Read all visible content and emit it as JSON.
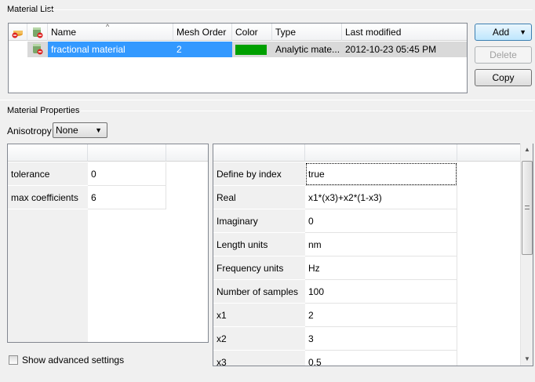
{
  "material_list": {
    "group_label": "Material List",
    "columns": [
      "Name",
      "Mesh Order",
      "Color",
      "Type",
      "Last modified"
    ],
    "rows": [
      {
        "name": "fractional material",
        "mesh_order": "2",
        "color": "#00a000",
        "type": "Analytic mate...",
        "last_modified": "2012-10-23 05:45 PM"
      }
    ],
    "buttons": {
      "add": "Add",
      "delete": "Delete",
      "copy": "Copy"
    }
  },
  "material_properties": {
    "group_label": "Material Properties",
    "anisotropy_label": "Anisotropy",
    "anisotropy_value": "None",
    "left_grid": [
      {
        "key": "tolerance",
        "value": "0"
      },
      {
        "key": "max coefficients",
        "value": "6"
      }
    ],
    "right_grid": [
      {
        "key": "Define by index",
        "value": "true"
      },
      {
        "key": "Real",
        "value": "x1*(x3)+x2*(1-x3)"
      },
      {
        "key": "Imaginary",
        "value": "0"
      },
      {
        "key": "Length units",
        "value": "nm"
      },
      {
        "key": "Frequency units",
        "value": "Hz"
      },
      {
        "key": "Number of samples",
        "value": "100"
      },
      {
        "key": "x1",
        "value": "2"
      },
      {
        "key": "x2",
        "value": "3"
      },
      {
        "key": "x3",
        "value": "0.5"
      }
    ],
    "show_advanced_label": "Show advanced settings"
  },
  "icons": [
    "add-material-icon",
    "delete-material-icon",
    "material-icon"
  ]
}
